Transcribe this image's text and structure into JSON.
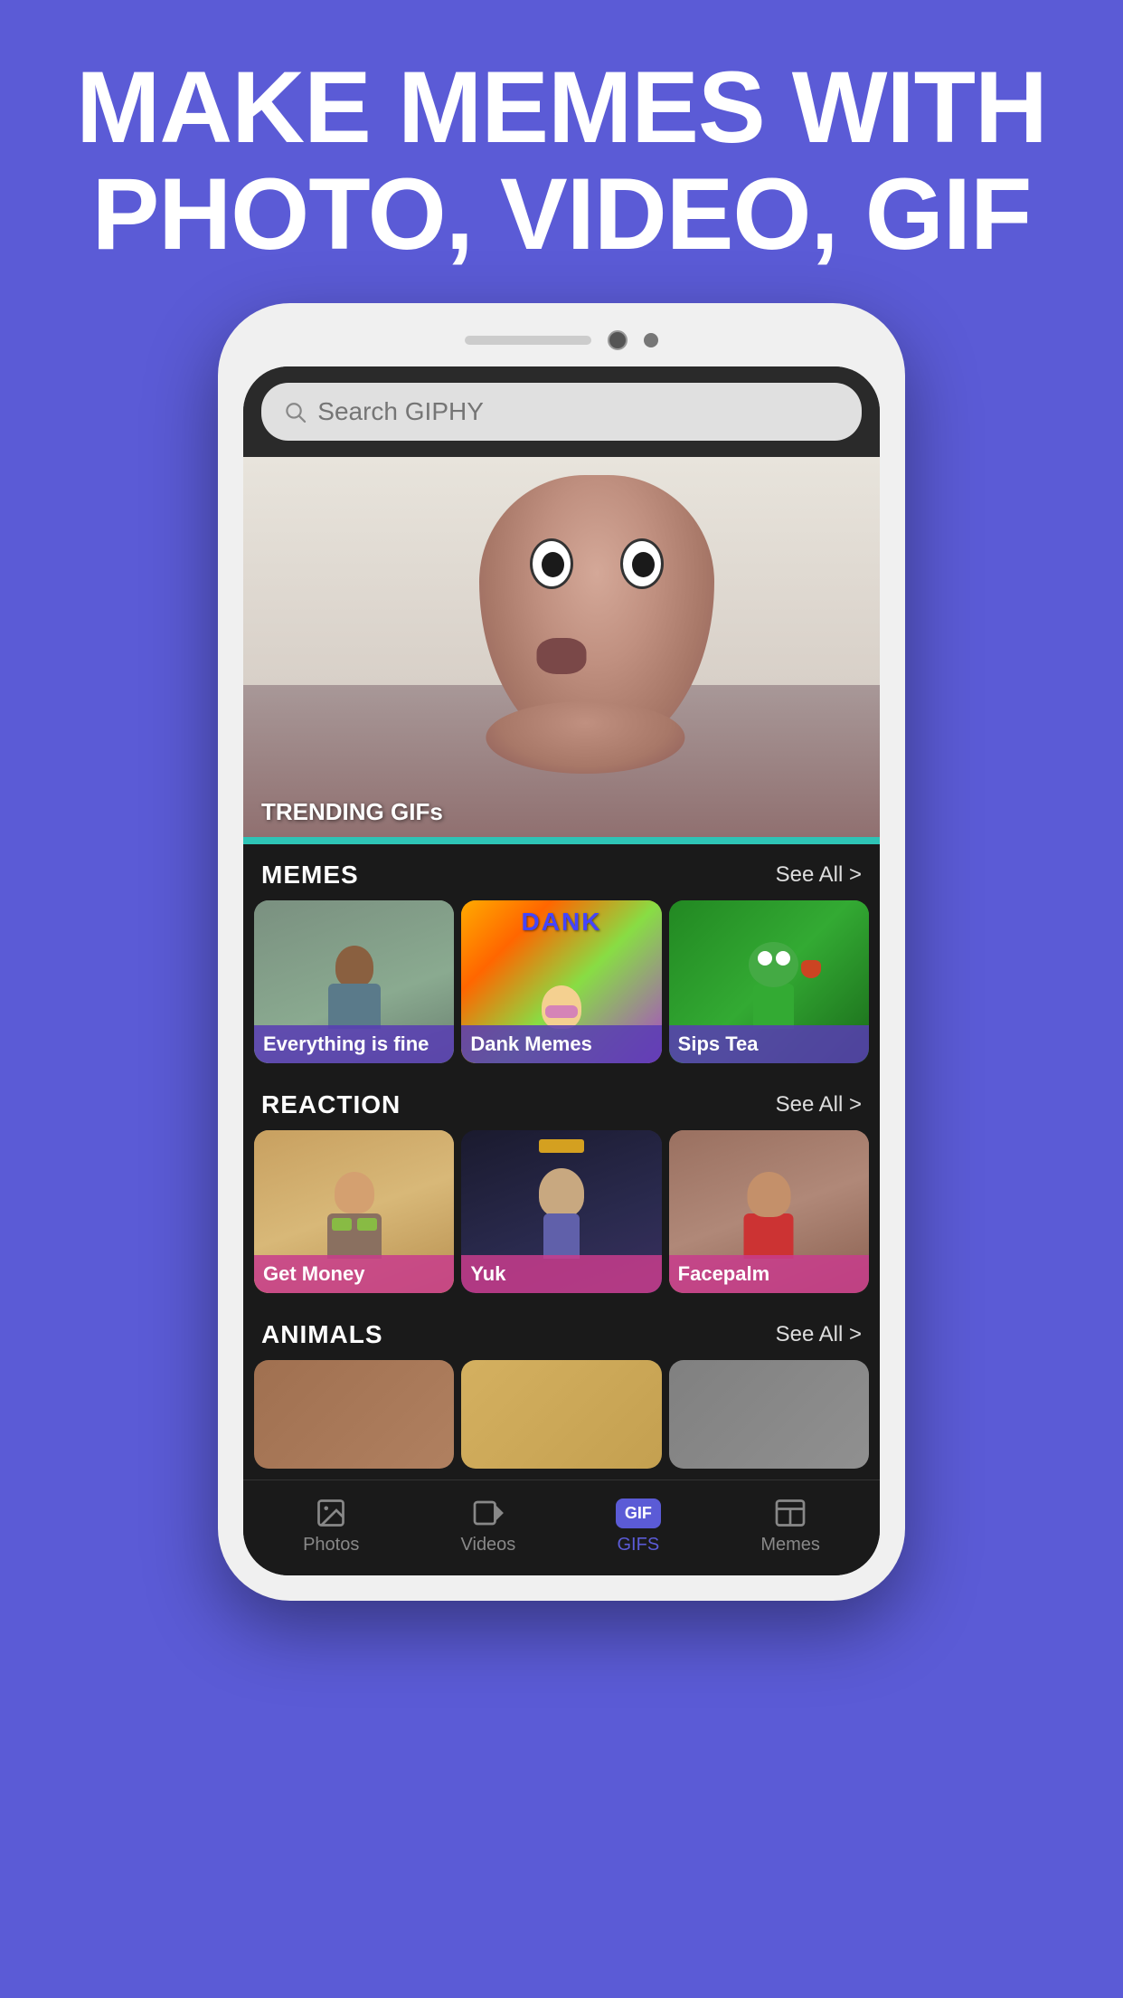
{
  "headline": {
    "line1": "MAKE MEMES WITH",
    "line2": "PHOTO, VIDEO, GIF"
  },
  "search": {
    "placeholder": "Search GIPHY"
  },
  "trending": {
    "label": "TRENDING GIFs"
  },
  "sections": {
    "memes": {
      "title": "MEMES",
      "see_all": "See All >"
    },
    "reaction": {
      "title": "REACTION",
      "see_all": "See All >"
    },
    "animals": {
      "title": "ANIMALS",
      "see_all": "See All >"
    }
  },
  "meme_cards": [
    {
      "label": "Everything is fine",
      "label_class": "label-purple"
    },
    {
      "label": "Dank Memes",
      "label_class": "label-purple"
    },
    {
      "label": "Sips Tea",
      "label_class": "label-purple"
    }
  ],
  "reaction_cards": [
    {
      "label": "Get Money",
      "label_class": "label-pink"
    },
    {
      "label": "Yuk",
      "label_class": "label-pink"
    },
    {
      "label": "Facepalm",
      "label_class": "label-pink"
    }
  ],
  "bottom_nav": [
    {
      "label": "Photos",
      "icon": "photos-icon",
      "active": false
    },
    {
      "label": "Videos",
      "icon": "videos-icon",
      "active": false
    },
    {
      "label": "GIFS",
      "icon": "gif-icon",
      "active": true
    },
    {
      "label": "Memes",
      "icon": "memes-icon",
      "active": false
    }
  ],
  "colors": {
    "bg": "#5B5BD6",
    "screen_bg": "#1a1a1a",
    "active_nav": "#5B5BD6",
    "trending_bar": "#2ec4b6"
  }
}
